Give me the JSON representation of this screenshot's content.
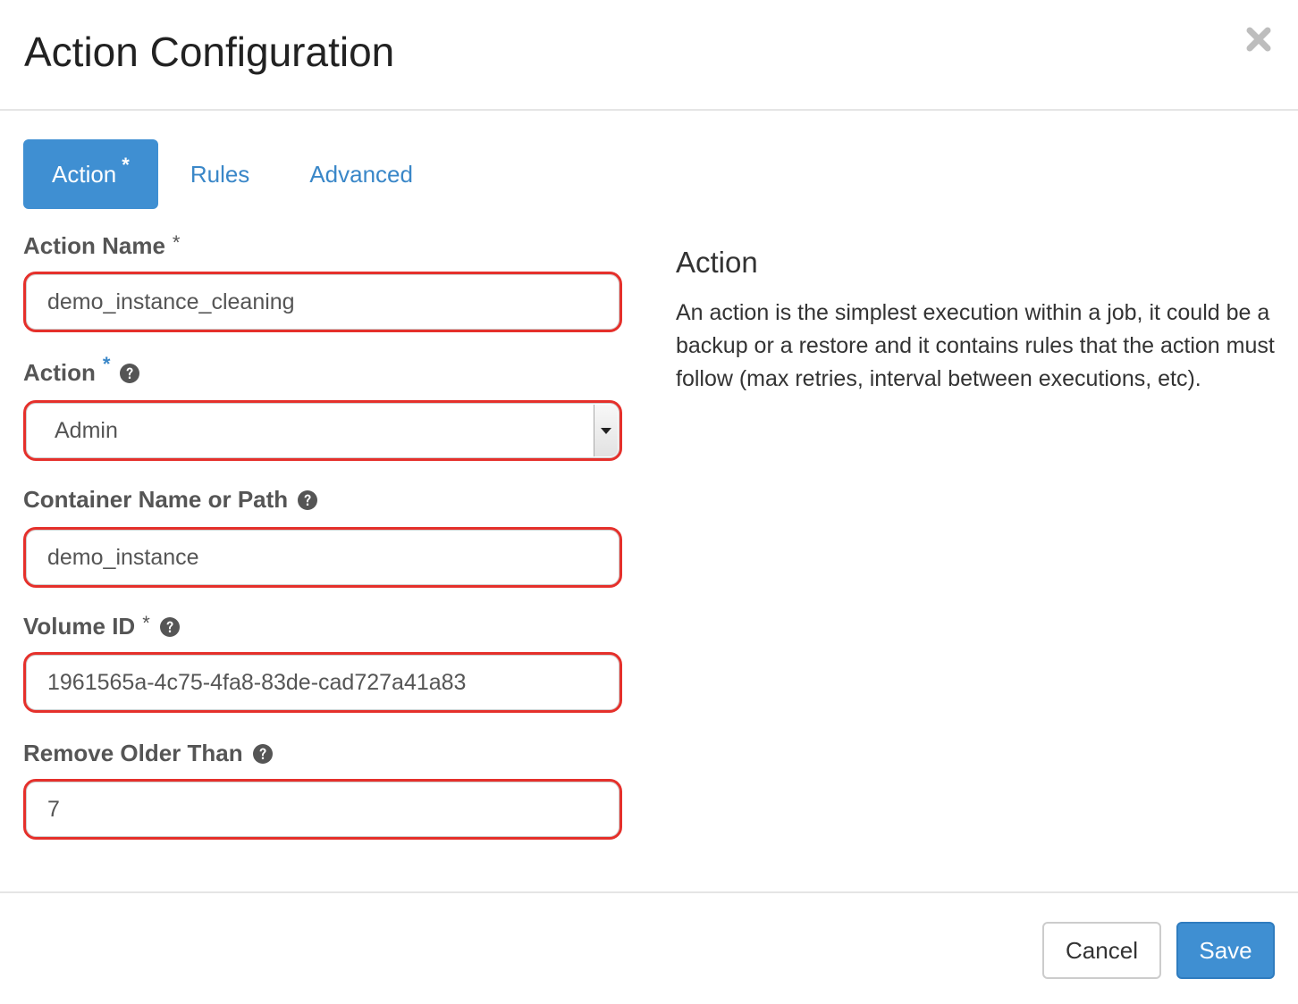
{
  "dialog": {
    "title": "Action Configuration",
    "close_icon": "close-icon"
  },
  "tabs": [
    {
      "label": "Action",
      "required_mark": "*",
      "active": true
    },
    {
      "label": "Rules",
      "active": false
    },
    {
      "label": "Advanced",
      "active": false
    }
  ],
  "form": {
    "action_name": {
      "label": "Action Name",
      "required_mark": "*",
      "value": "demo_instance_cleaning"
    },
    "action": {
      "label": "Action",
      "required_mark": "*",
      "help_icon": "question-circle-icon",
      "selected": "Admin"
    },
    "container": {
      "label": "Container Name or Path",
      "help_icon": "question-circle-icon",
      "value": "demo_instance"
    },
    "volume_id": {
      "label": "Volume ID",
      "required_mark": "*",
      "help_icon": "question-circle-icon",
      "value": "1961565a-4c75-4fa8-83de-cad727a41a83"
    },
    "remove_older_than": {
      "label": "Remove Older Than",
      "help_icon": "question-circle-icon",
      "value": "7"
    }
  },
  "help_panel": {
    "title": "Action",
    "text": "An action is the simplest execution within a job, it could be a backup or a restore and it contains rules that the action must follow (max retries, interval between executions, etc)."
  },
  "footer": {
    "cancel_label": "Cancel",
    "save_label": "Save"
  },
  "colors": {
    "accent": "#3f8fd2",
    "link": "#3a87c8",
    "highlight_border": "#e5302b"
  }
}
